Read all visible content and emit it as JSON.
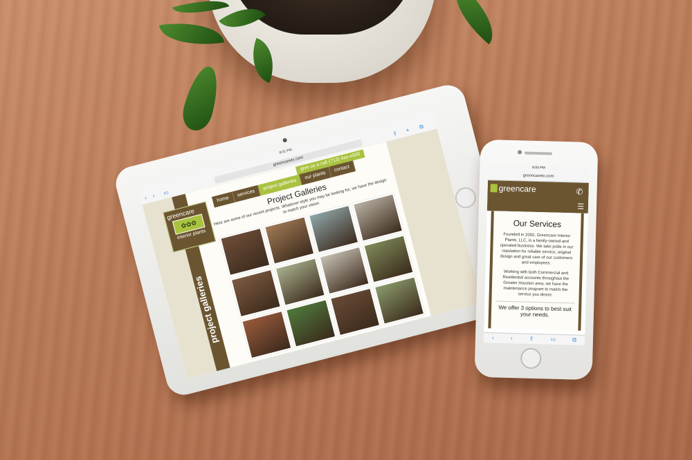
{
  "tablet": {
    "status_time": "8:01 PM",
    "url": "greencaretx.com",
    "nav": [
      "home",
      "services",
      "project galleries",
      "our plants",
      "contact"
    ],
    "active_nav": "project galleries",
    "call": "give us a call (713) 4xx-x500",
    "logo_name": "greencare",
    "logo_sub": "interior plants",
    "vertical_title": "project galleries",
    "heading": "Project Galleries",
    "intro": "Here are some of our recent projects. Whatever style you may be looking for, we have the design to match your vision.",
    "photo_colors": [
      "#6f4e3a",
      "#a07a55",
      "#8fa6a8",
      "#b9b1a3",
      "#7d5a40",
      "#a9b08d",
      "#c8c1b5",
      "#7e8a59",
      "#9a5a3c",
      "#4f7a3c",
      "#6a4a36",
      "#8a9a6a"
    ]
  },
  "phone": {
    "carrier": "Carrier",
    "status_time": "8:04 PM",
    "url": "greencaretx.com",
    "logo_name": "greencare",
    "heading": "Our Services",
    "p1": "Founded in 2002, Greencare Interior Plants, LLC, is a family-owned and operated business. We take pride in our reputation for reliable service, original design and great care of our customers and employees.",
    "p2": "Working with both Commercial and Residential accounts throughout the Greater Houston area, we have the maintenance program to match the service you desire.",
    "cta": "We offer 3 options to best suit your needs."
  },
  "colors": {
    "brand_brown": "#6b5530",
    "brand_green": "#a9c23f"
  }
}
